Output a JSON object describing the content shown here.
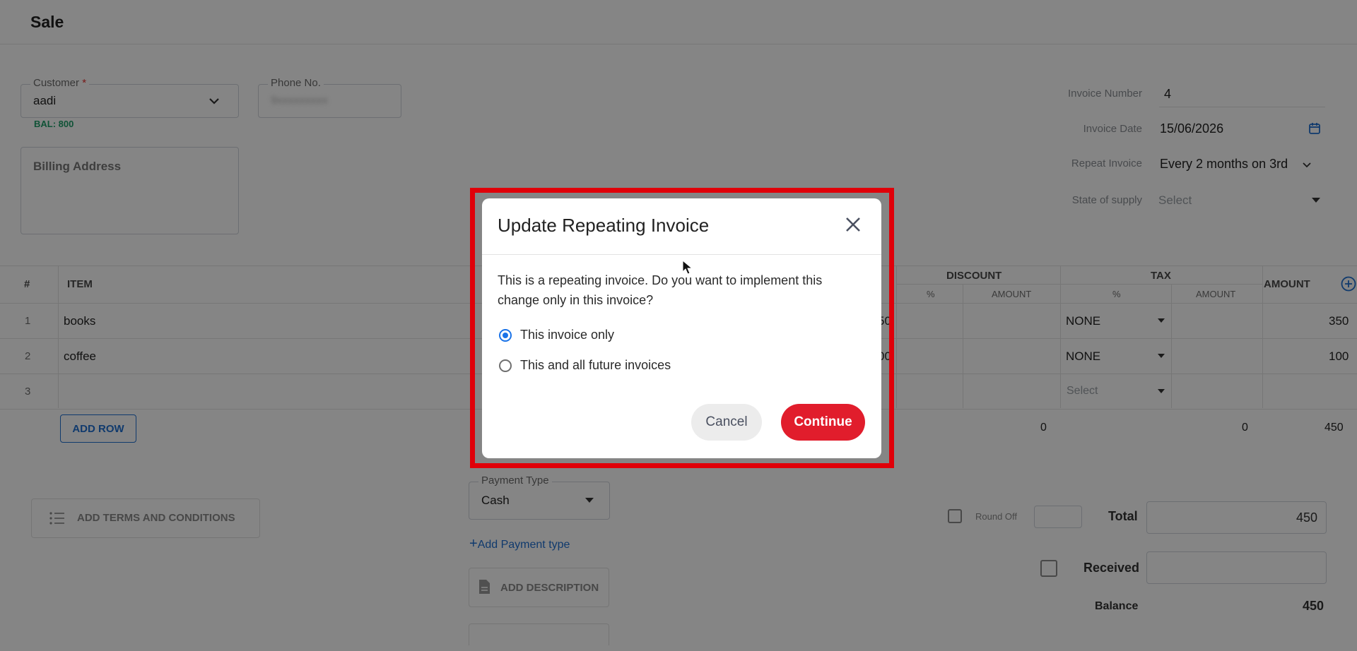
{
  "header": {
    "title": "Sale"
  },
  "customer": {
    "label": "Customer",
    "required_mark": "*",
    "value": "aadi",
    "balance": "BAL: 800"
  },
  "phone": {
    "label": "Phone No.",
    "value": "9xxxxxxxxx"
  },
  "billing": {
    "placeholder": "Billing Address"
  },
  "invoice": {
    "number_label": "Invoice Number",
    "number_value": "4",
    "date_label": "Invoice Date",
    "date_value": "15/06/2026",
    "repeat_label": "Repeat Invoice",
    "repeat_value": "Every 2 months on 3rd",
    "state_label": "State of supply",
    "state_value": "Select"
  },
  "table": {
    "headers": {
      "num": "#",
      "item": "ITEM",
      "discount": "DISCOUNT",
      "tax": "TAX",
      "amount": "AMOUNT",
      "pct": "%",
      "amount_sm": "AMOUNT"
    },
    "rows": [
      {
        "num": "1",
        "item": "books",
        "partial": "50",
        "tax": "NONE",
        "amount": "350"
      },
      {
        "num": "2",
        "item": "coffee",
        "partial": "00",
        "tax": "NONE",
        "amount": "100"
      },
      {
        "num": "3",
        "item": "",
        "partial": "",
        "tax": "Select",
        "amount": ""
      }
    ],
    "totals": {
      "discount": "0",
      "tax": "0",
      "amount": "450"
    },
    "add_row": "ADD ROW"
  },
  "footer": {
    "terms": "ADD TERMS AND CONDITIONS",
    "payment_type_label": "Payment Type",
    "payment_type_value": "Cash",
    "add_payment": "Add Payment type",
    "add_description": "ADD DESCRIPTION",
    "round_off": "Round Off",
    "total_label": "Total",
    "total_value": "450",
    "received_label": "Received",
    "received_value": "",
    "balance_label": "Balance",
    "balance_value": "450"
  },
  "modal": {
    "title": "Update Repeating Invoice",
    "message": "This is a repeating invoice. Do you want to implement this change only in this invoice?",
    "options": [
      "This invoice only",
      "This and all future invoices"
    ],
    "selected_option": "This invoice only",
    "cancel": "Cancel",
    "continue": "Continue",
    "continue_color": "#e11d2c",
    "highlight_color": "#e00009"
  }
}
